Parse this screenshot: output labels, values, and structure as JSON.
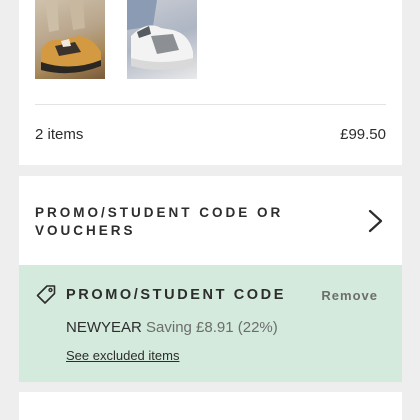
{
  "bag": {
    "thumbnails": [
      {
        "icon": "product-thumbnail-sneaker-tan"
      },
      {
        "icon": "product-thumbnail-sneaker-white"
      }
    ],
    "items_count": "2 items",
    "total": "£99.50"
  },
  "promo": {
    "title": "PROMO/STUDENT CODE OR VOUCHERS",
    "chevron_icon": "chevron-right-icon"
  },
  "applied_code": {
    "icon": "tag-icon",
    "title": "PROMO/STUDENT CODE",
    "remove_label": "Remove",
    "code": "NEWYEAR",
    "saving": "Saving £8.91 (22%)",
    "excluded_link": "See excluded items",
    "background_color": "#d3eadc"
  }
}
